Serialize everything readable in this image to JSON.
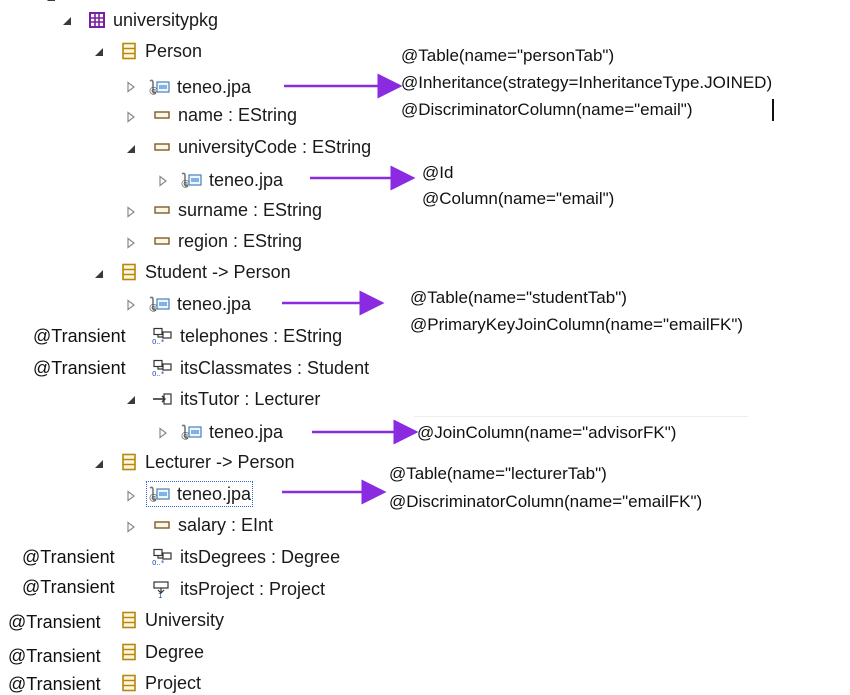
{
  "colors": {
    "arrow": "#8a2be2",
    "class_icon": "#b8860b",
    "package_icon": "#7b1fa2",
    "attr_icon": "#7a5c2e"
  },
  "tree": {
    "package": "universitypkg",
    "person": {
      "label": "Person",
      "jpa": "teneo.jpa",
      "name": "name : EString",
      "university_code": "universityCode : EString",
      "code_jpa": "teneo.jpa",
      "surname": "surname : EString",
      "region": "region : EString"
    },
    "student": {
      "label": "Student -> Person",
      "jpa": "teneo.jpa",
      "telephones": "telephones : EString",
      "classmates": "itsClassmates : Student",
      "tutor": "itsTutor : Lecturer",
      "tutor_jpa": "teneo.jpa"
    },
    "lecturer": {
      "label": "Lecturer -> Person",
      "jpa": "teneo.jpa",
      "salary": "salary : EInt",
      "degrees": "itsDegrees : Degree",
      "project": "itsProject : Project"
    },
    "university": "University",
    "degree": "Degree",
    "project_class": "Project"
  },
  "transient_tag": "@Transient",
  "annotations": {
    "person": [
      "@Table(name=\"personTab\")",
      "@Inheritance(strategy=InheritanceType.JOINED)",
      "@DiscriminatorColumn(name=\"email\")"
    ],
    "university_code": [
      "@Id",
      "@Column(name=\"email\")"
    ],
    "student": [
      "@Table(name=\"studentTab\")",
      "@PrimaryKeyJoinColumn(name=\"emailFK\")"
    ],
    "tutor": [
      "@JoinColumn(name=\"advisorFK\")"
    ],
    "lecturer": [
      "@Table(name=\"lecturerTab\")",
      "@DiscriminatorColumn(name=\"emailFK\")"
    ]
  }
}
